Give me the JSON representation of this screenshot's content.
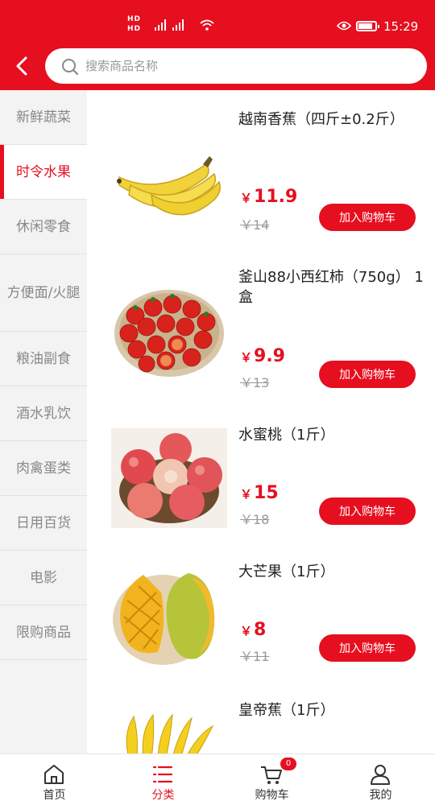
{
  "status_bar": {
    "sim_labels": [
      "HD",
      "HD"
    ],
    "network": "4G",
    "time": "15:29"
  },
  "search": {
    "placeholder": "搜索商品名称"
  },
  "colors": {
    "accent": "#e60f1f",
    "price": "#e60f1f",
    "sidebar_bg": "#f3f3f3"
  },
  "sidebar": {
    "items": [
      {
        "label": "新鲜蔬菜"
      },
      {
        "label": "时令水果",
        "active": true
      },
      {
        "label": "休闲零食"
      },
      {
        "label": "方便面/火腿"
      },
      {
        "label": "粮油副食"
      },
      {
        "label": "酒水乳饮"
      },
      {
        "label": "肉禽蛋类"
      },
      {
        "label": "日用百货"
      },
      {
        "label": "电影"
      },
      {
        "label": "限购商品"
      }
    ]
  },
  "products": [
    {
      "name": "越南香蕉（四斤±0.2斤）",
      "currency": "￥",
      "price": "11.9",
      "old_price": "￥14",
      "button": "加入购物车",
      "image": "banana"
    },
    {
      "name": "釜山88小西红柿（750g） 1盒",
      "currency": "￥",
      "price": "9.9",
      "old_price": "￥13",
      "button": "加入购物车",
      "image": "cherry-tomato"
    },
    {
      "name": "水蜜桃（1斤）",
      "currency": "￥",
      "price": "15",
      "old_price": "￥18",
      "button": "加入购物车",
      "image": "peach"
    },
    {
      "name": "大芒果（1斤）",
      "currency": "￥",
      "price": "8",
      "old_price": "￥11",
      "button": "加入购物车",
      "image": "mango"
    },
    {
      "name": "皇帝蕉（1斤）",
      "image": "baby-banana"
    }
  ],
  "bottom_nav": {
    "items": [
      {
        "label": "首页",
        "icon": "home-icon"
      },
      {
        "label": "分类",
        "icon": "category-list-icon",
        "active": true
      },
      {
        "label": "购物车",
        "icon": "cart-icon",
        "badge": "0"
      },
      {
        "label": "我的",
        "icon": "user-icon"
      }
    ]
  }
}
